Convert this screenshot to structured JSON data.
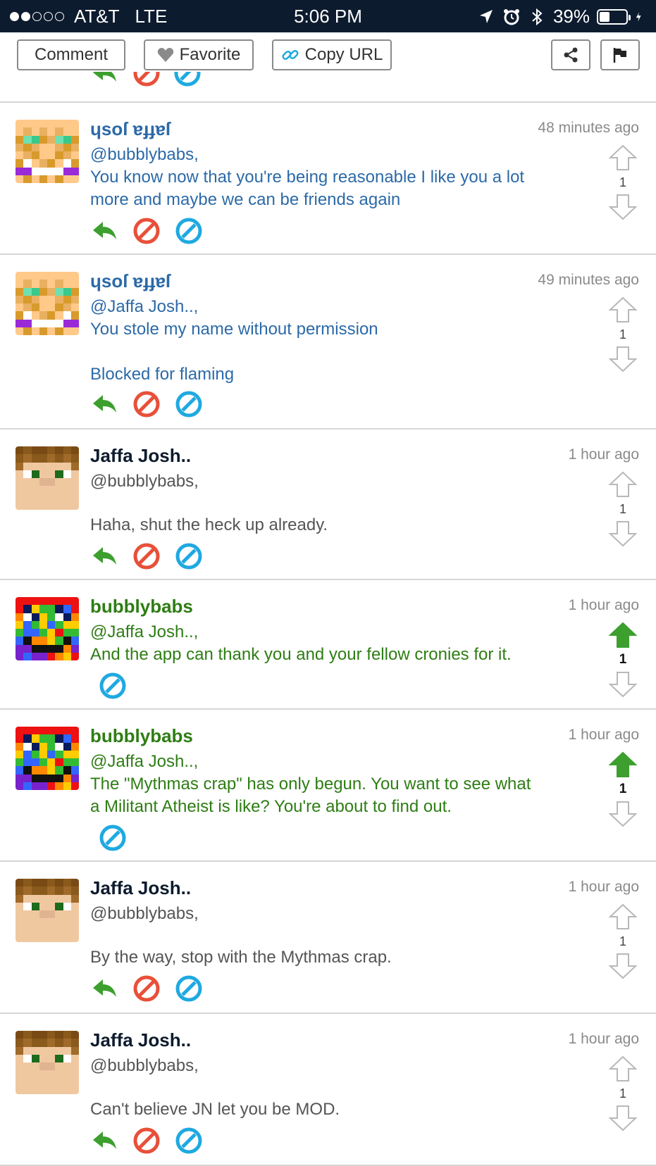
{
  "status_bar": {
    "carrier": "AT&T",
    "network": "LTE",
    "time": "5:06 PM",
    "battery": "39%",
    "battery_level": 0.39,
    "signal_bars_filled": 2,
    "signal_bars_total": 5
  },
  "toolbar": {
    "comment_label": "Comment",
    "favorite_label": "Favorite",
    "copy_url_label": "Copy URL"
  },
  "colors": {
    "blocked_text": "#2c6aa8",
    "mod_text": "#2e7d14",
    "normal_text": "#555555",
    "author_dark": "#0d1b2e",
    "reply_green": "#3c9f2e",
    "block_red": "#e8503a",
    "ignore_blue": "#1fa9e1",
    "upvote_active": "#3c9f2e"
  },
  "icons": [
    "reply-icon",
    "block-icon",
    "ignore-icon",
    "upvote-icon",
    "downvote-icon",
    "share-icon",
    "flag-icon",
    "heart-icon",
    "link-icon"
  ],
  "comments": [
    {
      "author": "ɥsoſ ɐɟɟɐſ",
      "time": "48 minutes ago",
      "mention": "@bubblybabs,",
      "text_line1": "You know now that you're being reasonable I like you a lot",
      "text_line2": "more and maybe we can be friends again",
      "votes": "1",
      "upvoted": false
    },
    {
      "author": "ɥsoſ ɐɟɟɐſ",
      "time": "49 minutes ago",
      "mention": "@Jaffa Josh..,",
      "text_line1": "You stole my name without permission",
      "note": "Blocked for flaming",
      "votes": "1",
      "upvoted": false
    },
    {
      "author": "Jaffa Josh..",
      "time": "1 hour ago",
      "mention": "@bubblybabs,",
      "text_line1": "Haha, shut the heck up already.",
      "votes": "1",
      "upvoted": false
    },
    {
      "author": "bubblybabs",
      "time": "1 hour ago",
      "mention": "@Jaffa Josh..,",
      "text_line1": "And the app can thank you and your fellow cronies for it.",
      "votes": "1",
      "upvoted": true
    },
    {
      "author": "bubblybabs",
      "time": "1 hour ago",
      "mention": "@Jaffa Josh..,",
      "text_line1": "The \"Mythmas crap\" has only begun. You want to see what",
      "text_line2": "a Militant Atheist is like? You're about to find out.",
      "votes": "1",
      "upvoted": true
    },
    {
      "author": "Jaffa Josh..",
      "time": "1 hour ago",
      "mention": "@bubblybabs,",
      "text_line1": "By the way, stop with the Mythmas crap.",
      "votes": "1",
      "upvoted": false
    },
    {
      "author": "Jaffa Josh..",
      "time": "1 hour ago",
      "mention": "@bubblybabs,",
      "text_line1": "Can't believe JN let you be MOD.",
      "votes": "1",
      "upvoted": false
    }
  ]
}
